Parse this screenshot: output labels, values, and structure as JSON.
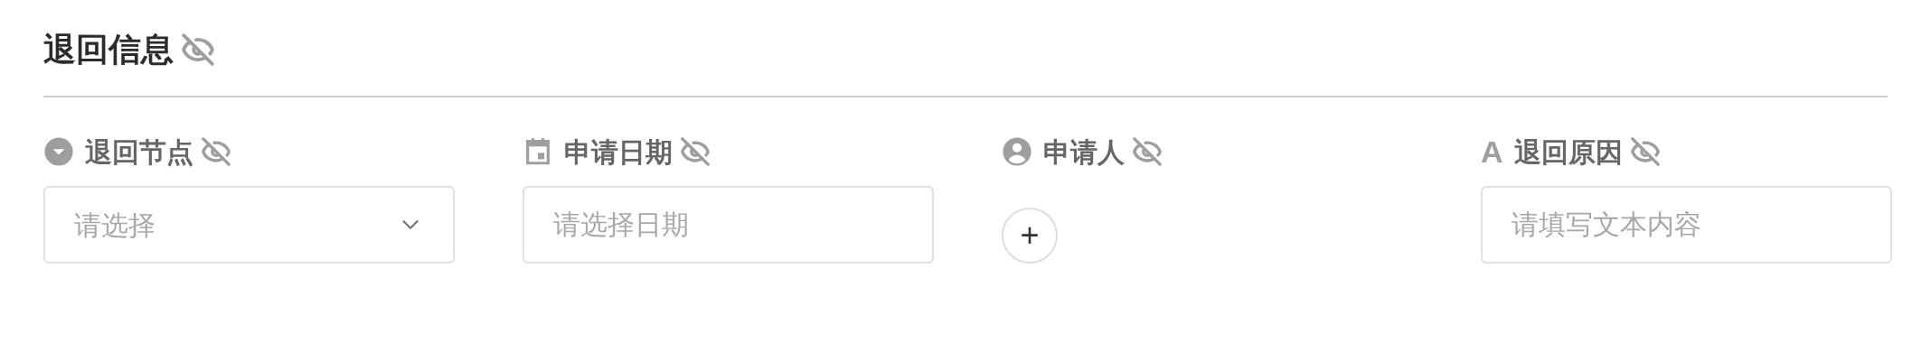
{
  "section": {
    "title": "退回信息"
  },
  "fields": [
    {
      "kind": "select",
      "label": "退回节点",
      "placeholder": "请选择"
    },
    {
      "kind": "date",
      "label": "申请日期",
      "placeholder": "请选择日期"
    },
    {
      "kind": "person",
      "label": "申请人",
      "add_symbol": "+"
    },
    {
      "kind": "text",
      "label": "退回原因",
      "icon_glyph": "A",
      "placeholder": "请填写文本内容"
    }
  ]
}
